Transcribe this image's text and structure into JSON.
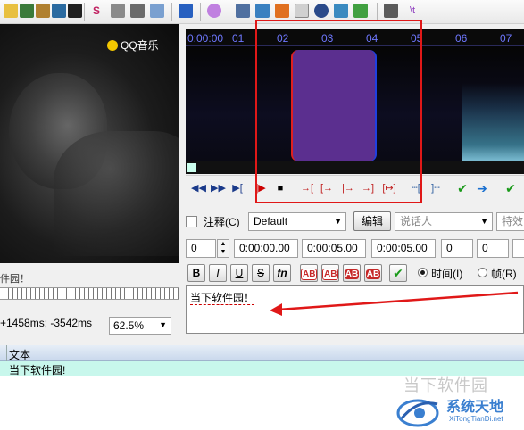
{
  "video": {
    "watermark": "QQ音乐",
    "subtitle_preview": "件园！",
    "offset_readout": "+1458ms; -3542ms",
    "zoom": "62.5%"
  },
  "audio": {
    "ruler_labels": [
      "0:00:00",
      "01",
      "02",
      "03",
      "04",
      "05",
      "06",
      "07"
    ],
    "selection_color": "#5b2f8f"
  },
  "style_row": {
    "comment_label": "注释(C)",
    "style_value": "Default",
    "edit_label": "编辑",
    "actor_placeholder": "说话人",
    "effect_placeholder": "特效"
  },
  "time_row": {
    "layer": "0",
    "start": "0:00:00.00",
    "end": "0:00:05.00",
    "duration": "0:00:05.00",
    "margin_l": "0",
    "margin_r": "0"
  },
  "format_row": {
    "bold": "B",
    "italic": "I",
    "underline": "U",
    "strike": "S",
    "fn": "fn",
    "color1": "AB",
    "color2": "AB",
    "color3": "AB",
    "color4": "AB",
    "radio_time": "时间(I)",
    "radio_frame": "帧(R)"
  },
  "editor": {
    "text": "当下软件园！"
  },
  "grid": {
    "header_text": "文本",
    "rows": [
      {
        "text": "当下软件园!"
      }
    ]
  },
  "watermarks": {
    "site_cn": "当下软件园",
    "brand": "系统天地",
    "brand_url": "XiTongTianDi.net"
  },
  "colors": {
    "accent_red": "#e01818",
    "grid_row_bg": "#c8f7ec"
  }
}
